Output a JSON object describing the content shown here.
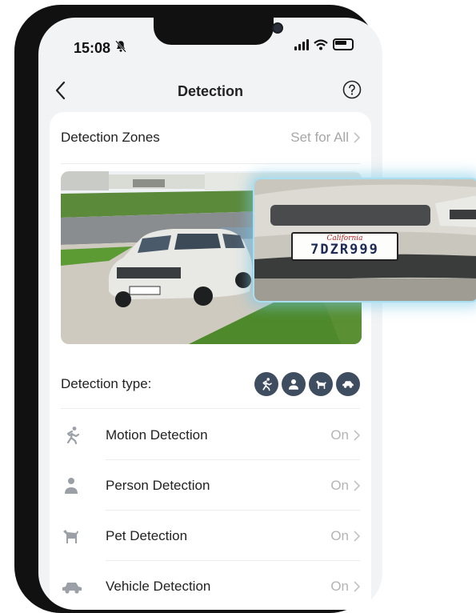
{
  "status_bar": {
    "time": "15:08"
  },
  "nav": {
    "title": "Detection"
  },
  "zones": {
    "label": "Detection Zones",
    "value": "Set for All"
  },
  "camera": {
    "plate_state": "California",
    "plate_number": "7DZR999"
  },
  "detection_type": {
    "label": "Detection type:",
    "badges": [
      "motion-icon",
      "person-icon",
      "pet-icon",
      "vehicle-icon"
    ]
  },
  "items": [
    {
      "name": "Motion Detection",
      "state": "On",
      "icon": "motion-icon"
    },
    {
      "name": "Person Detection",
      "state": "On",
      "icon": "person-icon"
    },
    {
      "name": "Pet Detection",
      "state": "On",
      "icon": "pet-icon"
    },
    {
      "name": "Vehicle Detection",
      "state": "On",
      "icon": "vehicle-icon"
    }
  ],
  "colors": {
    "badge_bg": "#3e4d60",
    "icon_gray": "#9aa0a6",
    "accent_glow": "#a9dff0"
  }
}
